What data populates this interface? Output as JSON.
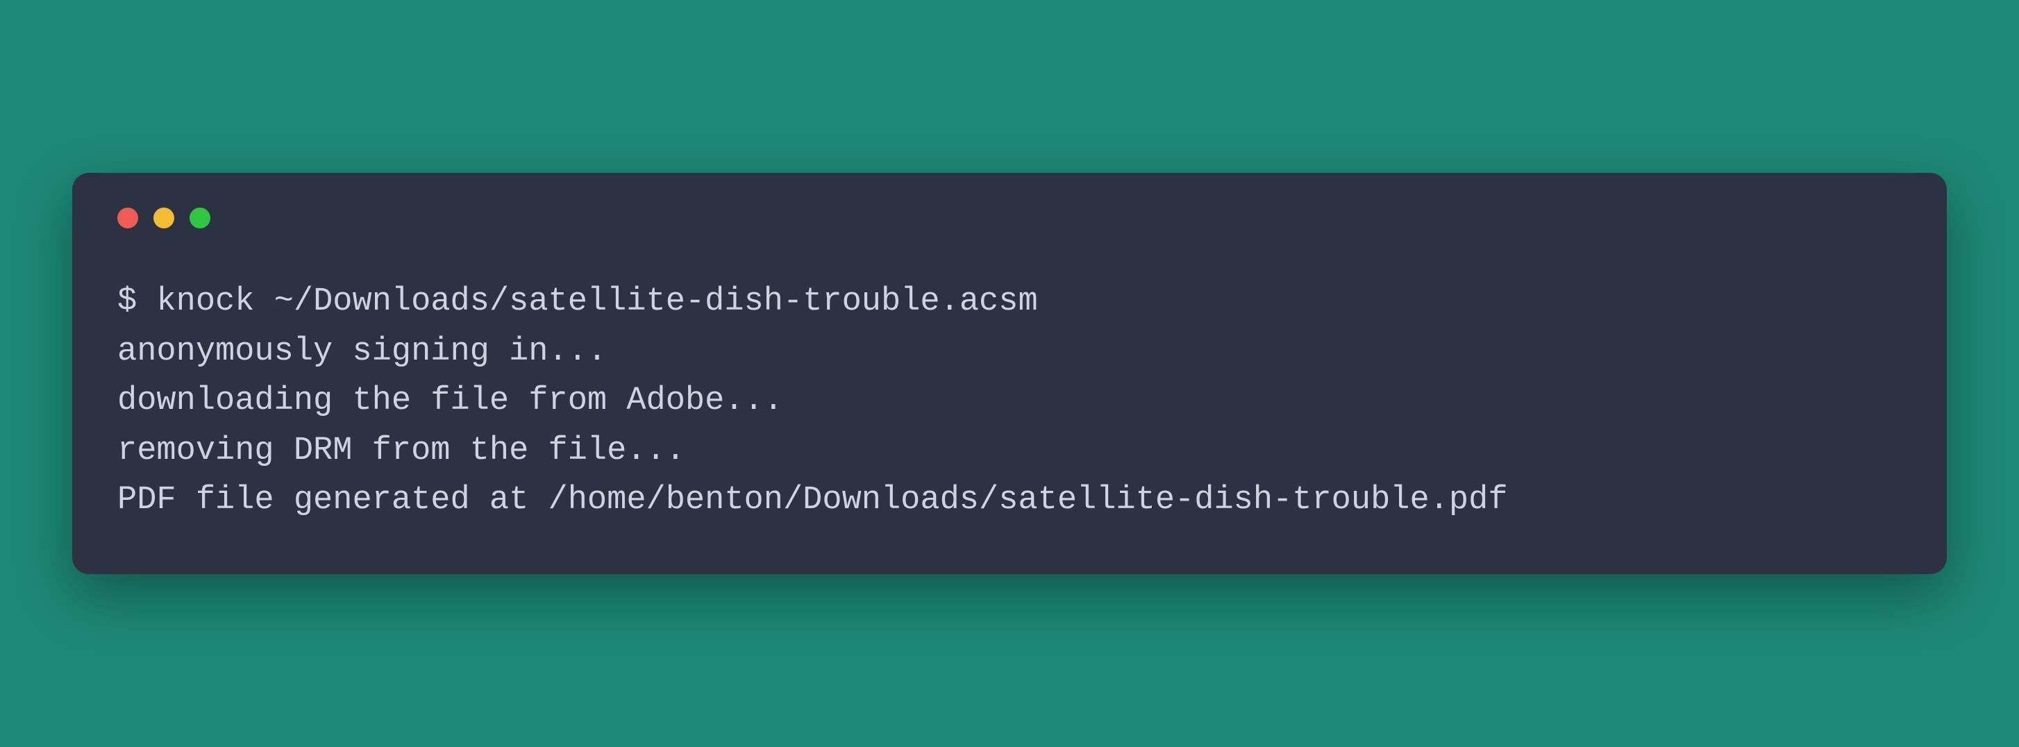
{
  "terminal": {
    "prompt": "$",
    "command": "knock ~/Downloads/satellite-dish-trouble.acsm",
    "output": [
      "anonymously signing in...",
      "downloading the file from Adobe...",
      "removing DRM from the file...",
      "PDF file generated at /home/benton/Downloads/satellite-dish-trouble.pdf"
    ]
  },
  "colors": {
    "background": "#1d8875",
    "terminal_bg": "#2b3242",
    "text": "#cdd3df",
    "dot_red": "#ee5c54",
    "dot_yellow": "#f4bc33",
    "dot_green": "#32c645"
  }
}
